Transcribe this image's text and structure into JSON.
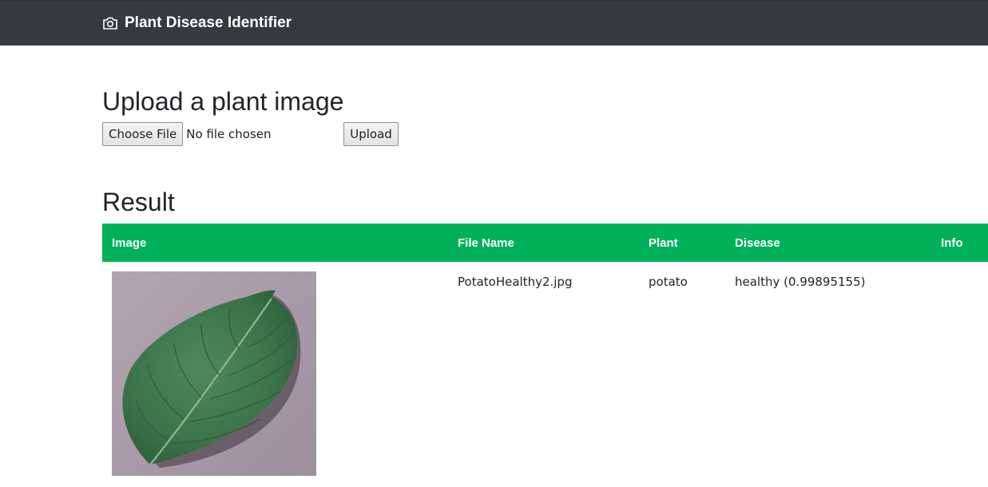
{
  "navbar": {
    "brand_label": "Plant Disease Identifier",
    "brand_icon": "camera-icon",
    "background": "#343a40"
  },
  "upload": {
    "title": "Upload a plant image",
    "choose_file_label": "Choose File",
    "file_status": "No file chosen",
    "upload_label": "Upload"
  },
  "result": {
    "title": "Result",
    "header_color": "#00b15a",
    "columns": [
      "Image",
      "File Name",
      "Plant",
      "Disease",
      "Info"
    ],
    "rows": [
      {
        "image": "potato-leaf-image",
        "file_name": "PotatoHealthy2.jpg",
        "plant": "potato",
        "disease": "healthy (0.99895155)",
        "info": ""
      }
    ]
  }
}
